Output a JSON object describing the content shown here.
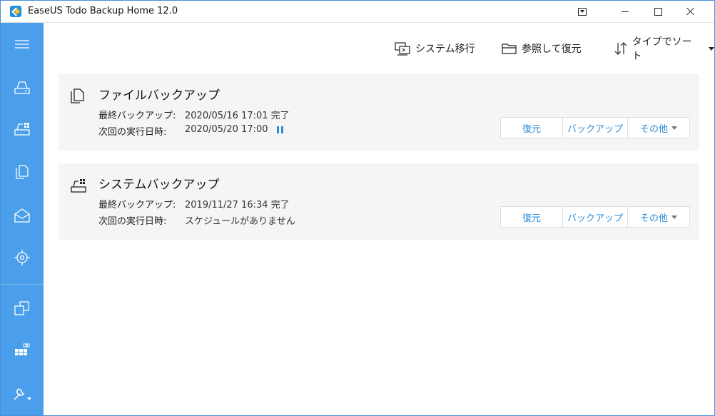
{
  "window": {
    "title": "EaseUS Todo Backup Home 12.0"
  },
  "titlebar_buttons": [
    "menu-icon",
    "minimize-icon",
    "maximize-icon",
    "close-icon"
  ],
  "sidebar": {
    "items": [
      {
        "icon": "hamburger-menu-icon"
      },
      {
        "icon": "disk-backup-icon"
      },
      {
        "icon": "system-backup-icon"
      },
      {
        "icon": "file-backup-icon"
      },
      {
        "icon": "mail-backup-icon"
      },
      {
        "icon": "smart-backup-icon"
      },
      {
        "icon": "clone-icon"
      },
      {
        "icon": "apps-icon"
      },
      {
        "icon": "tools-icon"
      }
    ]
  },
  "toolbar": {
    "migrate_label": "システム移行",
    "browse_restore_label": "参照して復元",
    "sort_label": "タイプでソート"
  },
  "labels": {
    "last_backup": "最終バックアップ:",
    "next_run": "次回の実行日時:"
  },
  "actions": {
    "restore": "復元",
    "backup": "バックアップ",
    "more": "その他"
  },
  "tasks": [
    {
      "title": "ファイルバックアップ",
      "last_backup": "2020/05/16 17:01 完了",
      "next_run": "2020/05/20 17:00",
      "icon": "file-copy-icon",
      "paused_indicator": true
    },
    {
      "title": "システムバックアップ",
      "last_backup": "2019/11/27 16:34 完了",
      "next_run": "スケジュールがありません",
      "icon": "system-drive-icon",
      "paused_indicator": false
    }
  ],
  "colors": {
    "sidebar": "#4a9eea",
    "accent": "#2a8bd8",
    "card_bg": "#f5f5f5"
  }
}
